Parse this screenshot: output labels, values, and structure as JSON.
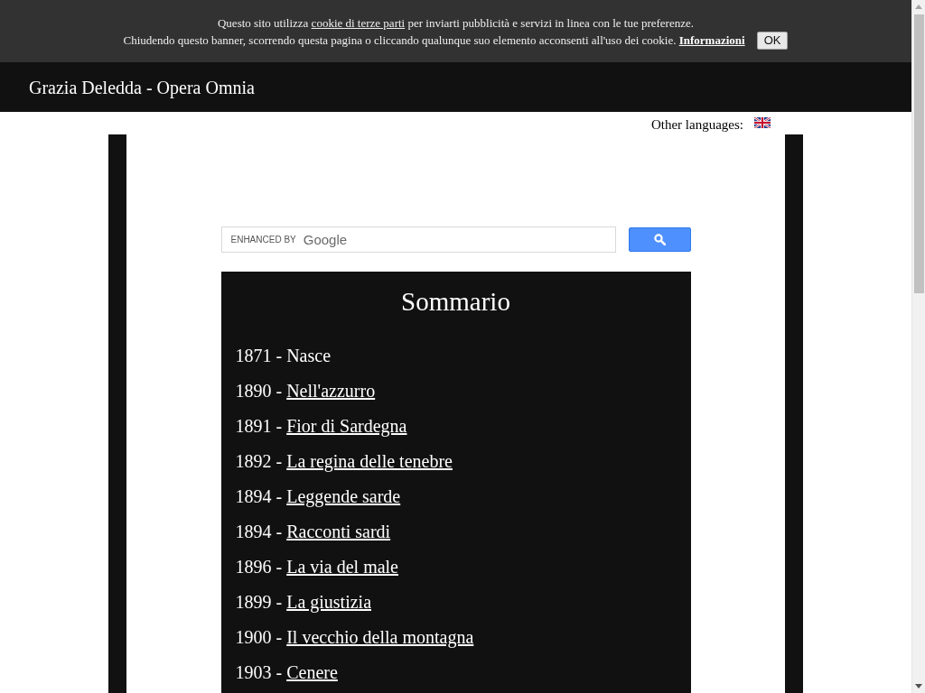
{
  "cookie_banner": {
    "line_1": {
      "before": "Questo sito utilizza",
      "link": "cookie di terze parti",
      "after": "per inviarti pubblicità e servizi in linea con le tue preferenze."
    },
    "line_2": {
      "text": "Chiudendo questo banner, scorrendo questa pagina o cliccando qualunque suo elemento acconsenti all'uso dei cookie.",
      "link": "Informazioni"
    },
    "button": "OK"
  },
  "header": {
    "site_title": "Grazia Deledda - Opera Omnia"
  },
  "languages": {
    "label": "Other languages:"
  },
  "search": {
    "branding": "ENHANCED BY",
    "brand_name": "Google"
  },
  "summary": {
    "title": "Sommario",
    "items": [
      {
        "year": "1871 -",
        "title": "Nasce",
        "kind": "text"
      },
      {
        "year": "1890 -",
        "title": "Nell'azzurro",
        "kind": "link"
      },
      {
        "year": "1891 -",
        "title": "Fior di Sardegna",
        "kind": "link"
      },
      {
        "year": "1892 -",
        "title": "La regina delle tenebre",
        "kind": "link"
      },
      {
        "year": "1894 -",
        "title": "Leggende sarde",
        "kind": "link"
      },
      {
        "year": "1894 -",
        "title": "Racconti sardi",
        "kind": "link"
      },
      {
        "year": "1896 -",
        "title": "La via del male",
        "kind": "link"
      },
      {
        "year": "1899 -",
        "title": "La giustizia",
        "kind": "link"
      },
      {
        "year": "1900 -",
        "title": "Il vecchio della montagna",
        "kind": "link"
      },
      {
        "year": "1903 -",
        "title": "Cenere",
        "kind": "link"
      }
    ]
  }
}
